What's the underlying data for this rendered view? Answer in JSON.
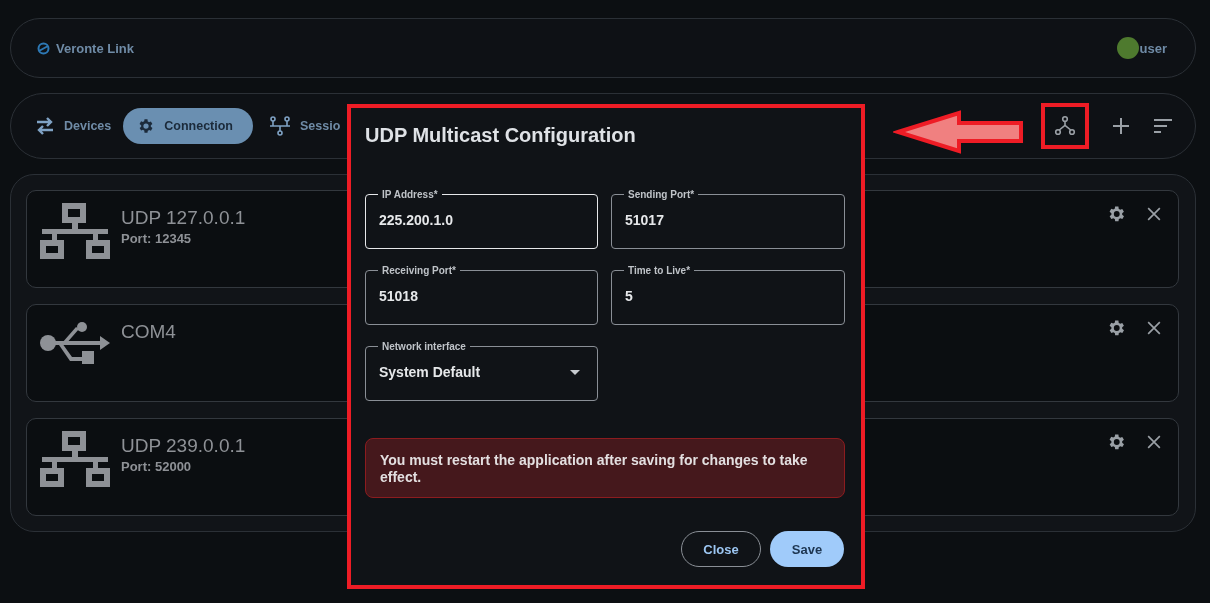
{
  "header": {
    "app_name": "Veronte Link",
    "user": "user"
  },
  "tabs": [
    {
      "kind": "swap",
      "label": "Devices",
      "selected": false
    },
    {
      "kind": "gear",
      "label": "Connection",
      "selected": true
    },
    {
      "kind": "tree",
      "label": "Sessio",
      "selected": false
    }
  ],
  "devices": [
    {
      "kind": "network",
      "name": "UDP 127.0.0.1",
      "detail": "Port: 12345"
    },
    {
      "kind": "usb",
      "name": "COM4"
    },
    {
      "kind": "network",
      "name": "UDP 239.0.0.1",
      "detail": "Port: 52000"
    }
  ],
  "dialog": {
    "title": "UDP Multicast Configuration",
    "fields": [
      {
        "kind": "text",
        "label": "IP Address*",
        "value": "225.200.1.0",
        "focused": true
      },
      {
        "kind": "text",
        "label": "Sending Port*",
        "value": "51017",
        "focused": false
      },
      {
        "kind": "text",
        "label": "Receiving Port*",
        "value": "51018",
        "focused": false
      },
      {
        "kind": "text",
        "label": "Time to Live*",
        "value": "5",
        "focused": false
      },
      {
        "kind": "select",
        "label": "Network interface",
        "value": "System Default",
        "focused": false
      }
    ],
    "notice": "You must restart the application after saving for changes to take effect.",
    "buttons": [
      {
        "kind": "outlined",
        "label": "Close"
      },
      {
        "kind": "filled",
        "label": "Save"
      }
    ]
  }
}
